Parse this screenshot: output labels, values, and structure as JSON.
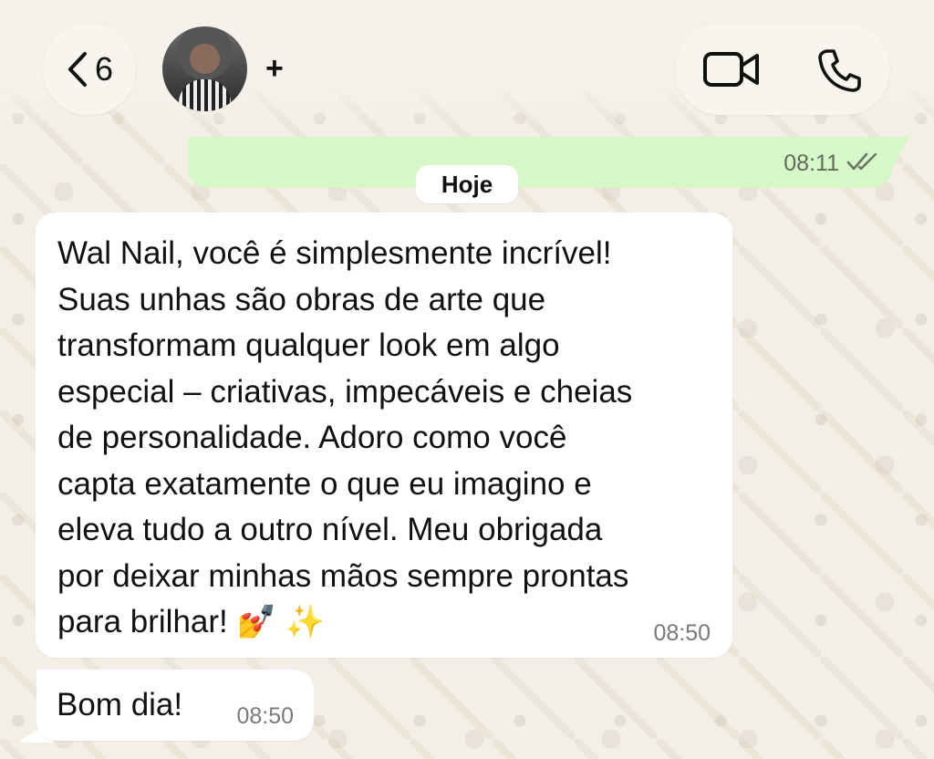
{
  "header": {
    "back_count": "6",
    "plus_label": "+",
    "icons": {
      "back": "chevron-left-icon",
      "video": "video-camera-icon",
      "phone": "phone-icon"
    }
  },
  "chat": {
    "outgoing": {
      "time": "08:11",
      "status": "read-double-check"
    },
    "date_chip": "Hoje",
    "messages": [
      {
        "text": "Wal Nail, você é simplesmente incrível!\nSuas unhas são obras de arte que\ntransformam qualquer look em algo\nespecial – criativas, impecáveis e cheias\nde personalidade. Adoro como você\ncapta exatamente o que eu imagino e\neleva tudo a outro nível. Meu obrigada\npor deixar minhas mãos sempre prontas\npara brilhar!",
        "emoji_1": "💅",
        "emoji_2": "✨",
        "time": "08:50"
      },
      {
        "text": "Bom dia!",
        "time": "08:50"
      }
    ]
  },
  "colors": {
    "wallpaper": "#f3eee6",
    "outgoing_bubble": "#d6f7c7",
    "incoming_bubble": "#ffffff",
    "timestamp": "#7a7a7a"
  }
}
